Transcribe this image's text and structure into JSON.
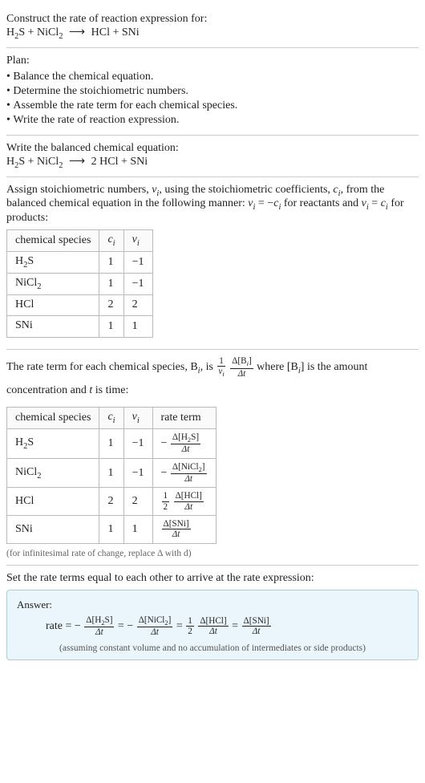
{
  "prompt": {
    "title": "Construct the rate of reaction expression for:",
    "equation_lhs1": "H",
    "equation_lhs1_sub": "2",
    "equation_lhs1_tail": "S + NiCl",
    "equation_lhs1_sub2": "2",
    "equation_prod": "HCl + SNi"
  },
  "plan": {
    "title": "Plan:",
    "items": [
      "Balance the chemical equation.",
      "Determine the stoichiometric numbers.",
      "Assemble the rate term for each chemical species.",
      "Write the rate of reaction expression."
    ]
  },
  "balanced": {
    "title": "Write the balanced chemical equation:",
    "lhs_a": "H",
    "sub1": "2",
    "lhs_b": "S + NiCl",
    "sub2": "2",
    "arrow": "⟶",
    "rhs": "2 HCl + SNi"
  },
  "stoich_intro": {
    "line1a": "Assign stoichiometric numbers, ",
    "nu": "ν",
    "i": "i",
    "line1b": ", using the stoichiometric coefficients, ",
    "c": "c",
    "line1c": ", from",
    "line2a": "the balanced chemical equation in the following manner: ",
    "eq_reac": " = −",
    "line2b": " for reactants",
    "line3a": "and ",
    "eq_prod": " = ",
    "line3b": " for products:"
  },
  "table1": {
    "headers": {
      "h1": "chemical species",
      "h2": "c",
      "h3": "ν"
    },
    "rows": [
      {
        "sp_a": "H",
        "sp_sub": "2",
        "sp_b": "S",
        "c": "1",
        "nu": "−1"
      },
      {
        "sp_a": "NiCl",
        "sp_sub": "2",
        "sp_b": "",
        "c": "1",
        "nu": "−1"
      },
      {
        "sp_a": "HCl",
        "sp_sub": "",
        "sp_b": "",
        "c": "2",
        "nu": "2"
      },
      {
        "sp_a": "SNi",
        "sp_sub": "",
        "sp_b": "",
        "c": "1",
        "nu": "1"
      }
    ]
  },
  "rate_intro": {
    "part1": "The rate term for each chemical species, B",
    "part1b": ", is ",
    "frac1_num": "1",
    "frac1_den_a": "ν",
    "frac2_num": "Δ[B",
    "frac2_num_b": "]",
    "frac2_den": "Δt",
    "part2a": " where [B",
    "part2b": "] is the amount",
    "line2": "concentration and ",
    "t": "t",
    "line2b": " is time:"
  },
  "table2": {
    "headers": {
      "h1": "chemical species",
      "h2": "c",
      "h3": "ν",
      "h4": "rate term"
    },
    "rows": [
      {
        "sp_a": "H",
        "sp_sub": "2",
        "sp_b": "S",
        "c": "1",
        "nu": "−1",
        "rt_neg": "−",
        "rt_coef_num": "",
        "rt_coef_den": "",
        "rt_num_a": "Δ[H",
        "rt_num_sub": "2",
        "rt_num_b": "S]",
        "rt_den": "Δt"
      },
      {
        "sp_a": "NiCl",
        "sp_sub": "2",
        "sp_b": "",
        "c": "1",
        "nu": "−1",
        "rt_neg": "−",
        "rt_coef_num": "",
        "rt_coef_den": "",
        "rt_num_a": "Δ[NiCl",
        "rt_num_sub": "2",
        "rt_num_b": "]",
        "rt_den": "Δt"
      },
      {
        "sp_a": "HCl",
        "sp_sub": "",
        "sp_b": "",
        "c": "2",
        "nu": "2",
        "rt_neg": "",
        "rt_coef_num": "1",
        "rt_coef_den": "2",
        "rt_num_a": "Δ[HCl]",
        "rt_num_sub": "",
        "rt_num_b": "",
        "rt_den": "Δt"
      },
      {
        "sp_a": "SNi",
        "sp_sub": "",
        "sp_b": "",
        "c": "1",
        "nu": "1",
        "rt_neg": "",
        "rt_coef_num": "",
        "rt_coef_den": "",
        "rt_num_a": "Δ[SNi]",
        "rt_num_sub": "",
        "rt_num_b": "",
        "rt_den": "Δt"
      }
    ],
    "footnote": "(for infinitesimal rate of change, replace Δ with d)"
  },
  "final": {
    "title": "Set the rate terms equal to each other to arrive at the rate expression:"
  },
  "answer": {
    "label": "Answer:",
    "rate": "rate = ",
    "neg": "−",
    "eq": " = ",
    "t1_num_a": "Δ[H",
    "t1_num_sub": "2",
    "t1_num_b": "S]",
    "t1_den": "Δt",
    "t2_num_a": "Δ[NiCl",
    "t2_num_sub": "2",
    "t2_num_b": "]",
    "t2_den": "Δt",
    "coef_num": "1",
    "coef_den": "2",
    "t3_num": "Δ[HCl]",
    "t3_den": "Δt",
    "t4_num": "Δ[SNi]",
    "t4_den": "Δt",
    "note": "(assuming constant volume and no accumulation of intermediates or side products)"
  }
}
